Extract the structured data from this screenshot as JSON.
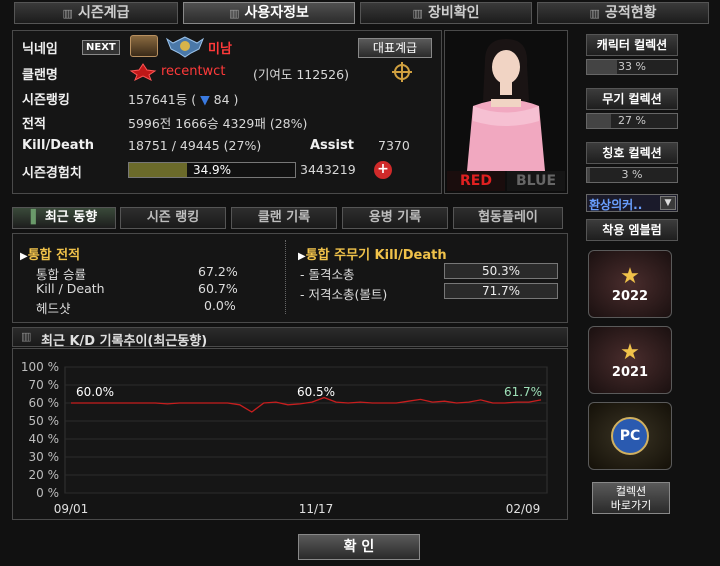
{
  "tabs": [
    "시즌계급",
    "사용자정보",
    "장비확인",
    "공적현황"
  ],
  "profile": {
    "nickname_label": "닉네임",
    "next_badge": "NEXT",
    "nickname": "미남",
    "clan_label": "클랜명",
    "clan_name": "recentwct",
    "clan_contrib": "(기여도 112526)",
    "season_rank_label": "시즌랭킹",
    "season_rank": "157641등",
    "rank_change": "84",
    "record_label": "전적",
    "record": "5996전 1666승 4329패 (28%)",
    "kd_label": "Kill/Death",
    "kd": "18751 / 49445 (27%)",
    "assist_label": "Assist",
    "assist": "7370",
    "exp_label": "시즌경험치",
    "exp_percent": "34.9%",
    "exp_fill": 0.349,
    "exp_total": "3443219",
    "rep_rank_button": "대표계급"
  },
  "team": {
    "red": "RED",
    "blue": "BLUE"
  },
  "subtabs": [
    "최근 동향",
    "시즌 랭킹",
    "클랜 기록",
    "용병 기록",
    "협동플레이"
  ],
  "combined": {
    "title": "통합 전적",
    "rows": [
      {
        "label": "통합 승률",
        "value": "67.2%"
      },
      {
        "label": "Kill / Death",
        "value": "60.7%"
      },
      {
        "label": "헤드샷",
        "value": "0.0%"
      }
    ]
  },
  "weapon": {
    "title": "통합 주무기 Kill/Death",
    "rows": [
      {
        "label": "- 돌격소총",
        "value": "50.3%"
      },
      {
        "label": "- 저격소총(볼트)",
        "value": "71.7%"
      }
    ]
  },
  "graph_title": "최근 K/D 기록추이(최근동향)",
  "chart_data": {
    "type": "line",
    "ylim": [
      0,
      100
    ],
    "yticks": [
      "100 %",
      "70 %",
      "60 %",
      "50 %",
      "40 %",
      "30 %",
      "20 %",
      "0 %"
    ],
    "xticks": [
      "09/01",
      "11/17",
      "02/09"
    ],
    "annotations": [
      "60.0%",
      "60.5%",
      "61.7%"
    ],
    "values": [
      60,
      60,
      60,
      60,
      60,
      60,
      60,
      60,
      59.5,
      60,
      60,
      60,
      60,
      60,
      59,
      55,
      60,
      60.5,
      59,
      59.5,
      60.5,
      63,
      60.5,
      60,
      60.5,
      60,
      60,
      60,
      61,
      62,
      60.5,
      61,
      60,
      60.5,
      61.7,
      60,
      60,
      60.5,
      60.5,
      61.7
    ]
  },
  "side": {
    "char_collection": "캐릭터 컬렉션",
    "char_pct": "33 %",
    "char_fill": 0.33,
    "weapon_collection": "무기 컬렉션",
    "weapon_pct": "27 %",
    "weapon_fill": 0.27,
    "title_collection": "칭호 컬렉션",
    "title_pct": "3 %",
    "title_fill": 0.03,
    "dropdown": "환상의커..",
    "emblem_label": "착용 엠블럼",
    "emblems": [
      "2022",
      "2021",
      "PC"
    ],
    "shortcut": "컬렉션\n바로가기"
  },
  "confirm": "확 인"
}
